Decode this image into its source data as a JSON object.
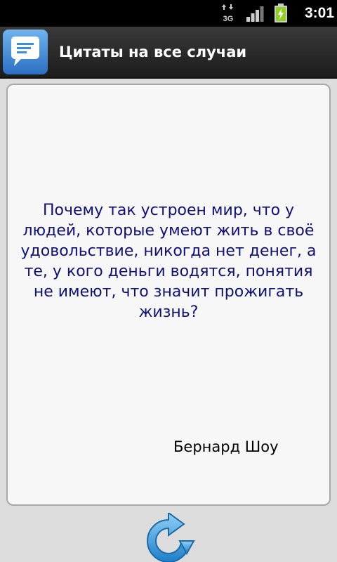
{
  "status_bar": {
    "network_type": "3G",
    "time": "3:01"
  },
  "title_bar": {
    "title": "Цитаты на все случаи"
  },
  "quote": {
    "text": "Почему так устроен мир, что у людей, которые умеют жить в своё удовольствие, никогда нет денег, а те, у кого деньги водятся, понятия не имеют, что значит прожигать жизнь?",
    "author": "Бернард Шоу"
  },
  "colors": {
    "quote_text": "#101077",
    "title_bar": "#2a2a2a",
    "background": "#dcdcdc",
    "accent_blue": "#3a8fd8"
  },
  "icons": {
    "app": "speech-bubble-icon",
    "refresh": "refresh-icon"
  }
}
